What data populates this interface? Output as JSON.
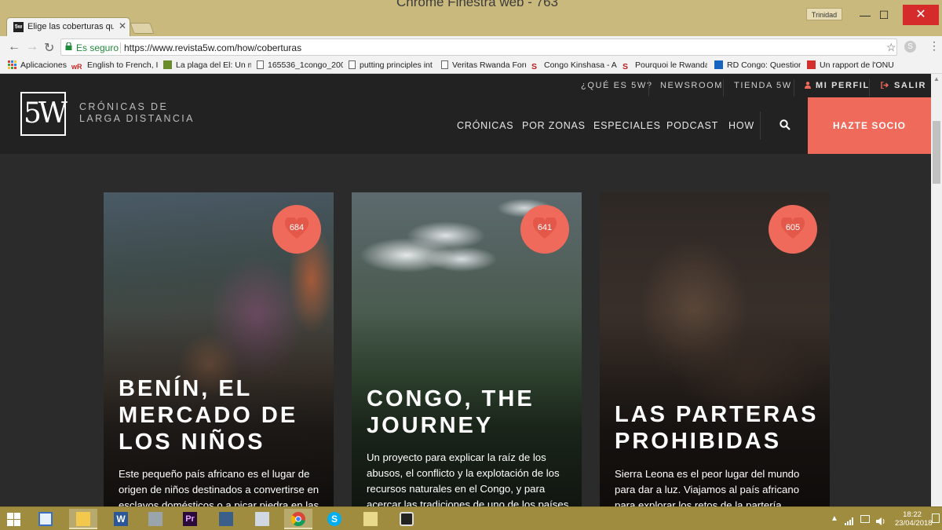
{
  "browser": {
    "window_title": "Chrome Finestra web - 763",
    "profile": "Trinidad",
    "tab": {
      "title": "Elige las coberturas que",
      "favicon_text": "5w"
    },
    "secure_label": "Es seguro",
    "url": "https://www.revista5w.com/how/coberturas",
    "bookmarks": [
      {
        "label": "Aplicaciones",
        "icon": "apps-grid-icon"
      },
      {
        "label": "English to French, Ital",
        "icon": "wordreference-icon"
      },
      {
        "label": "La plaga del El: Un m",
        "icon": "rt-icon"
      },
      {
        "label": "165536_1congo_2002",
        "icon": "page-icon"
      },
      {
        "label": "putting principles int",
        "icon": "page-icon"
      },
      {
        "label": "Veritas Rwanda Foru",
        "icon": "page-icon"
      },
      {
        "label": "Congo Kinshasa - A c",
        "icon": "s-icon"
      },
      {
        "label": "Pourquoi le Rwanda",
        "icon": "s-icon"
      },
      {
        "label": "RD Congo: Question",
        "icon": "blue-square-icon"
      },
      {
        "label": "Un rapport de l'ONU",
        "icon": "rfi-icon"
      }
    ]
  },
  "site": {
    "logo": "5W",
    "tagline_line1": "CRÓNICAS DE",
    "tagline_line2": "LARGA DISTANCIA",
    "top_nav": [
      "¿QUÉ ES 5W?",
      "NEWSROOM",
      "TIENDA 5W",
      "MI PERFIL",
      "SALIR"
    ],
    "main_nav": [
      "CRÓNICAS",
      "POR ZONAS",
      "ESPECIALES",
      "PODCAST",
      "HOW"
    ],
    "cta": "HAZTE SOCIO",
    "accent_color": "#ef6a5b"
  },
  "cards": [
    {
      "count": "684",
      "title": "BENÍN, EL\nMERCADO DE\nLOS NIÑOS",
      "description": "Este pequeño país africano es el lugar de origen de niños destinados a convertirse en esclavos domésticos o a picar piedra en las canteras de Nigeria."
    },
    {
      "count": "641",
      "title": "CONGO, THE\nJOURNEY",
      "description": "Un proyecto para explicar la raíz de los abusos, el conflicto y la explotación de los recursos naturales en el Congo, y para acercar las tradiciones de uno de los países más intensos de África."
    },
    {
      "count": "605",
      "title": "LAS PARTERAS\nPROHIBIDAS",
      "description": "Sierra Leona es el peor lugar del mundo para dar a luz. Viajamos al país africano para explorar los retos de la partería tradicional y la vida de las sierraleonesas."
    }
  ],
  "taskbar": {
    "apps": [
      "media-player-icon",
      "file-explorer-icon",
      "word-icon",
      "calculator-icon",
      "premiere-icon",
      "monitor-icon",
      "pen-icon",
      "chrome-icon",
      "skype-icon",
      "folder-icon",
      "camera-app-icon"
    ],
    "time": "18:22",
    "date": "23/04/2018"
  }
}
